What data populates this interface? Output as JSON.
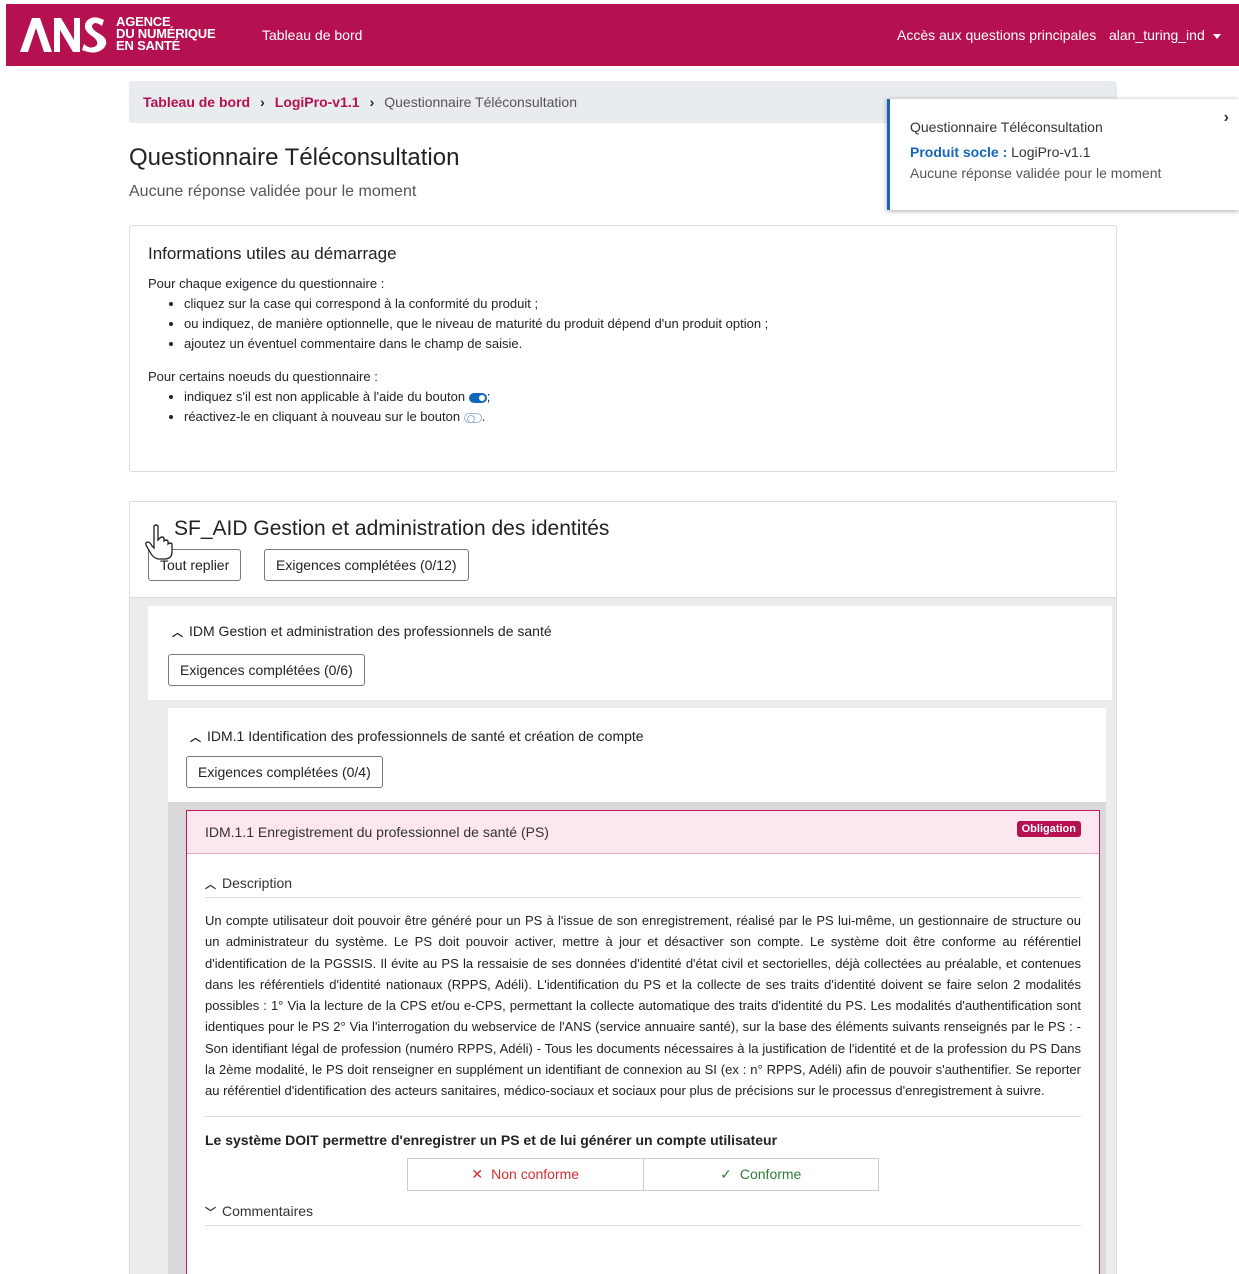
{
  "navbar": {
    "logo_lines": [
      "AGENCE",
      "DU NUMÉRIQUE",
      "EN SANTÉ"
    ],
    "dashboard": "Tableau de bord",
    "main_questions": "Accès aux questions principales",
    "user": "alan_turing_ind",
    "brand_color": "#b5104f"
  },
  "breadcrumb": {
    "items": [
      "Tableau de bord",
      "LogiPro-v1.1"
    ],
    "current": "Questionnaire Téléconsultation"
  },
  "page": {
    "title": "Questionnaire Téléconsultation",
    "subtitle": "Aucune réponse validée pour le moment"
  },
  "toast": {
    "title": "Questionnaire Téléconsultation",
    "product_label": "Produit socle :",
    "product_value": "LogiPro-v1.1",
    "status": "Aucune réponse validée pour le moment"
  },
  "info": {
    "heading": "Informations utiles au démarrage",
    "intro1": "Pour chaque exigence du questionnaire :",
    "list1": [
      "cliquez sur la case qui correspond à la conformité du produit ;",
      "ou indiquez, de manière optionnelle, que le niveau de maturité du produit dépend d'un produit option ;",
      "ajoutez un éventuel commentaire dans le champ de saisie."
    ],
    "intro2": "Pour certains noeuds du questionnaire :",
    "list2_a": "indiquez s'il est non applicable à l'aide du bouton",
    "list2_a_end": ";",
    "list2_b": "réactivez-le en cliquant à nouveau sur le bouton",
    "list2_b_end": "."
  },
  "section": {
    "title": "SF_AID Gestion et administration des identités",
    "collapse_all": "Tout replier",
    "completed": "Exigences complétées (0/12)"
  },
  "idm": {
    "title": "IDM Gestion et administration des professionnels de santé",
    "completed": "Exigences complétées (0/6)"
  },
  "idm1": {
    "title": "IDM.1 Identification des professionnels de santé et création de compte",
    "completed": "Exigences complétées (0/4)"
  },
  "requirement": {
    "title": "IDM.1.1 Enregistrement du professionnel de santé (PS)",
    "badge": "Obligation",
    "description_label": "Description",
    "description": "Un compte utilisateur doit pouvoir être généré pour un PS à l'issue de son enregistrement, réalisé par le PS lui-même, un gestionnaire de structure ou un administrateur du système. Le PS doit pouvoir activer, mettre à jour et désactiver son compte. Le système doit être conforme au référentiel d'identification de la PGSSIS. Il évite au PS la ressaisie de ses données d'identité d'état civil et sectorielles, déjà collectées au préalable, et contenues dans les référentiels d'identité nationaux (RPPS, Adéli). L'identification du PS et la collecte de ses traits d'identité doivent se faire selon 2 modalités possibles : 1° Via la lecture de la CPS et/ou e-CPS, permettant la collecte automatique des traits d'identité du PS. Les modalités d'authentification sont identiques pour le PS 2° Via l'interrogation du webservice de l'ANS (service annuaire santé), sur la base des éléments suivants renseignés par le PS : - Son identifiant légal de profession (numéro RPPS, Adéli) - Tous les documents nécessaires à la justification de l'identité et de la profession du PS Dans la 2ème modalité, le PS doit renseigner en supplément un identifiant de connexion au SI (ex : n° RPPS, Adéli) afin de pouvoir s'authentifier. Se reporter au référentiel d'identification des acteurs sanitaires, médico-sociaux et sociaux pour plus de précisions sur le processus d'enregistrement à suivre.",
    "statement": "Le système DOIT permettre d'enregistrer un PS et de lui générer un compte utilisateur",
    "non_conforme": "Non conforme",
    "conforme": "Conforme",
    "comments_label": "Commentaires"
  }
}
